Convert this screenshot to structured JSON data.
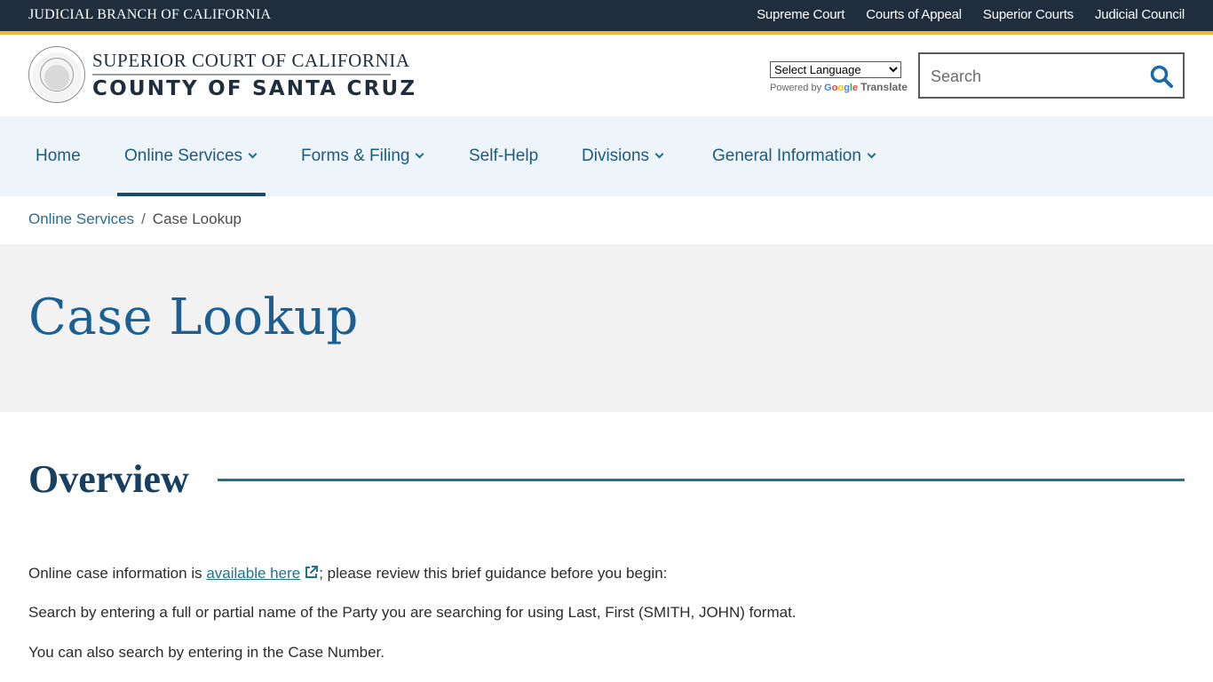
{
  "utility_bar": {
    "brand": "JUDICIAL BRANCH OF CALIFORNIA",
    "links": [
      "Supreme Court",
      "Courts of Appeal",
      "Superior Courts",
      "Judicial Council"
    ],
    "accent_color": "#f0b634",
    "background_color": "#1f2d3d"
  },
  "header": {
    "seal_icon": "judicial-branch-seal",
    "logo_line1": "SUPERIOR COURT OF CALIFORNIA",
    "logo_line2": "COUNTY OF SANTA CRUZ",
    "translate": {
      "selected_language": "Select Language",
      "powered_by": "Powered by",
      "google": "Google",
      "translate": "Translate"
    },
    "search": {
      "placeholder": "Search",
      "value": "",
      "icon": "search-icon"
    }
  },
  "nav": {
    "items": [
      {
        "label": "Home",
        "has_dropdown": false,
        "active": false
      },
      {
        "label": "Online Services",
        "has_dropdown": true,
        "active": true
      },
      {
        "label": "Forms & Filing",
        "has_dropdown": true,
        "active": false
      },
      {
        "label": "Self-Help",
        "has_dropdown": false,
        "active": false
      },
      {
        "label": "Divisions",
        "has_dropdown": true,
        "active": false
      },
      {
        "label": "General Information",
        "has_dropdown": true,
        "active": false
      }
    ]
  },
  "breadcrumb": {
    "parent": "Online Services",
    "separator": "/",
    "current": "Case Lookup"
  },
  "page": {
    "title": "Case Lookup",
    "section_heading": "Overview",
    "paragraphs": {
      "p1_before": "Online case information is ",
      "p1_link": "available here",
      "p1_after": "; please review this brief guidance before you begin:",
      "p2": "Search by entering a full or partial name of the Party you are searching for using Last, First (SMITH, JOHN) format.",
      "p3": "You can also search by entering in the Case Number."
    }
  }
}
